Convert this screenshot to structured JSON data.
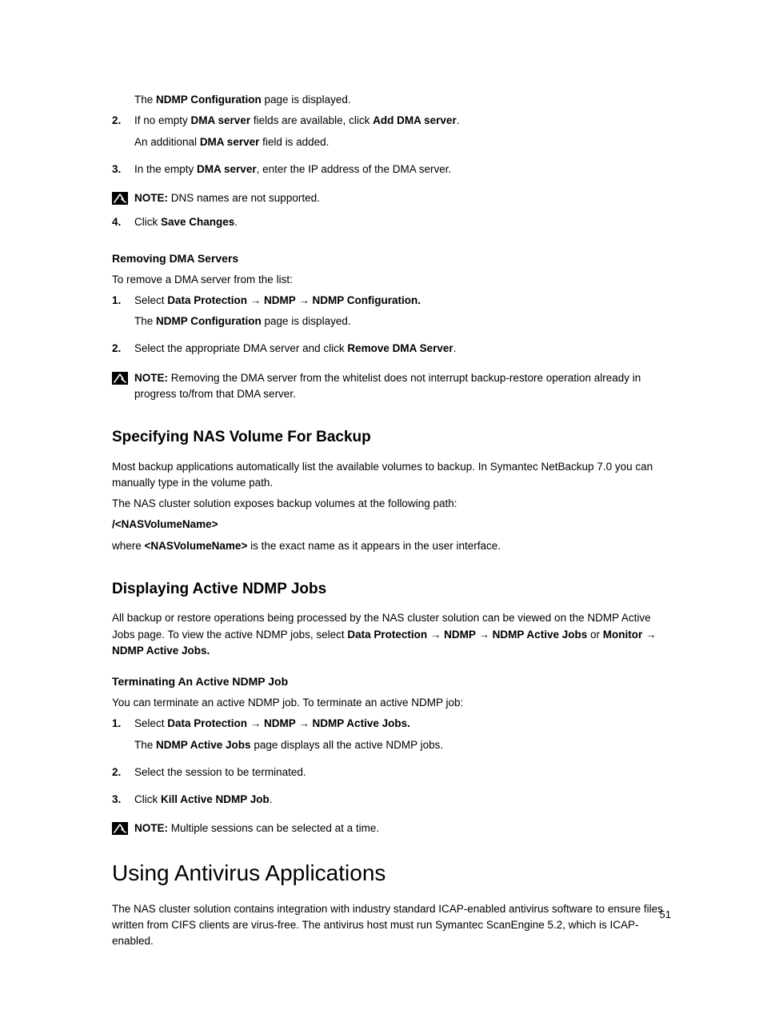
{
  "intro_line_pre": "The ",
  "intro_line_bold": "NDMP Configuration",
  "intro_line_post": " page is displayed.",
  "step2_num": "2.",
  "step2_l1_a": "If no empty ",
  "step2_l1_b": "DMA server",
  "step2_l1_c": " fields are available, click ",
  "step2_l1_d": "Add DMA server",
  "step2_l1_e": ".",
  "step2_l2_a": "An additional ",
  "step2_l2_b": "DMA server",
  "step2_l2_c": " field is added.",
  "step3_num": "3.",
  "step3_a": "In the empty ",
  "step3_b": "DMA server",
  "step3_c": ", enter the IP address of the DMA server.",
  "note1_label": "NOTE: ",
  "note1_text": "DNS names are not supported.",
  "step4_num": "4.",
  "step4_a": "Click ",
  "step4_b": "Save Changes",
  "step4_c": ".",
  "h_remove": "Removing DMA Servers",
  "remove_intro": "To remove a DMA server from the list:",
  "r1_num": "1.",
  "r1_a": "Select ",
  "r1_b": "Data Protection → NDMP → NDMP Configuration.",
  "r1_l2_a": "The ",
  "r1_l2_b": "NDMP Configuration",
  "r1_l2_c": " page is displayed.",
  "r2_num": "2.",
  "r2_a": "Select the appropriate DMA server and click ",
  "r2_b": "Remove DMA Server",
  "r2_c": ".",
  "note2_label": "NOTE: ",
  "note2_text": "Removing the DMA server from the whitelist does not interrupt backup-restore operation already in progress to/from that DMA server.",
  "h_specify": "Specifying NAS Volume For Backup",
  "specify_p1": "Most backup applications automatically list the available volumes to backup. In Symantec NetBackup 7.0 you can manually type in the volume path.",
  "specify_p2": "The NAS cluster solution exposes backup volumes at the following path:",
  "specify_path": "/<NASVolumeName>",
  "specify_p3_a": "where ",
  "specify_p3_b": "<NASVolumeName>",
  "specify_p3_c": " is the exact name as it appears in the user interface.",
  "h_display": "Displaying Active NDMP Jobs",
  "display_p_a": "All backup or restore operations being processed by the NAS cluster solution can be viewed on the NDMP Active Jobs page. To view the active NDMP jobs, select ",
  "display_p_b": "Data Protection → NDMP → NDMP Active Jobs",
  "display_p_c": " or ",
  "display_p_d": "Monitor → NDMP Active Jobs.",
  "h_terminate": "Terminating An Active NDMP Job",
  "terminate_intro": "You can terminate an active NDMP job. To terminate an active NDMP job:",
  "t1_num": "1.",
  "t1_a": "Select ",
  "t1_b": "Data Protection → NDMP → NDMP Active Jobs.",
  "t1_l2_a": "The ",
  "t1_l2_b": "NDMP Active Jobs",
  "t1_l2_c": " page displays all the active NDMP jobs.",
  "t2_num": "2.",
  "t2_text": "Select the session to be terminated.",
  "t3_num": "3.",
  "t3_a": "Click ",
  "t3_b": "Kill Active NDMP Job",
  "t3_c": ".",
  "note3_label": "NOTE: ",
  "note3_text": "Multiple sessions can be selected at a time.",
  "h_major": "Using Antivirus Applications",
  "major_p": "The NAS cluster solution contains integration with industry standard ICAP-enabled antivirus software to ensure files written from CIFS clients are virus-free. The antivirus host must run Symantec ScanEngine 5.2, which is ICAP-enabled.",
  "page_number": "51"
}
